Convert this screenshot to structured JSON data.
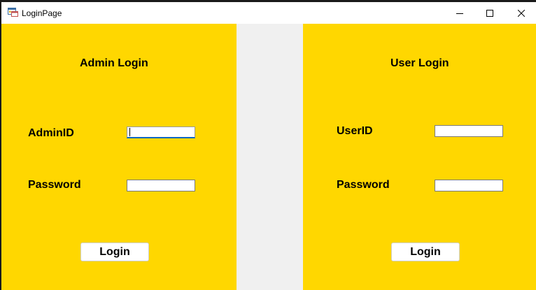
{
  "window": {
    "title": "LoginPage",
    "icon": "form-window-icon",
    "controls": [
      "minimize-icon",
      "maximize-icon",
      "close-icon"
    ]
  },
  "colors": {
    "panel_background": "#ffd700",
    "window_background": "#f0f0f0",
    "focus_accent": "#0067c0"
  },
  "admin": {
    "heading": "Admin Login",
    "id_label": "AdminID",
    "id_value": "",
    "password_label": "Password",
    "password_value": "",
    "login_label": "Login"
  },
  "user": {
    "heading": "User Login",
    "id_label": "UserID",
    "id_value": "",
    "password_label": "Password",
    "password_value": "",
    "login_label": "Login"
  }
}
